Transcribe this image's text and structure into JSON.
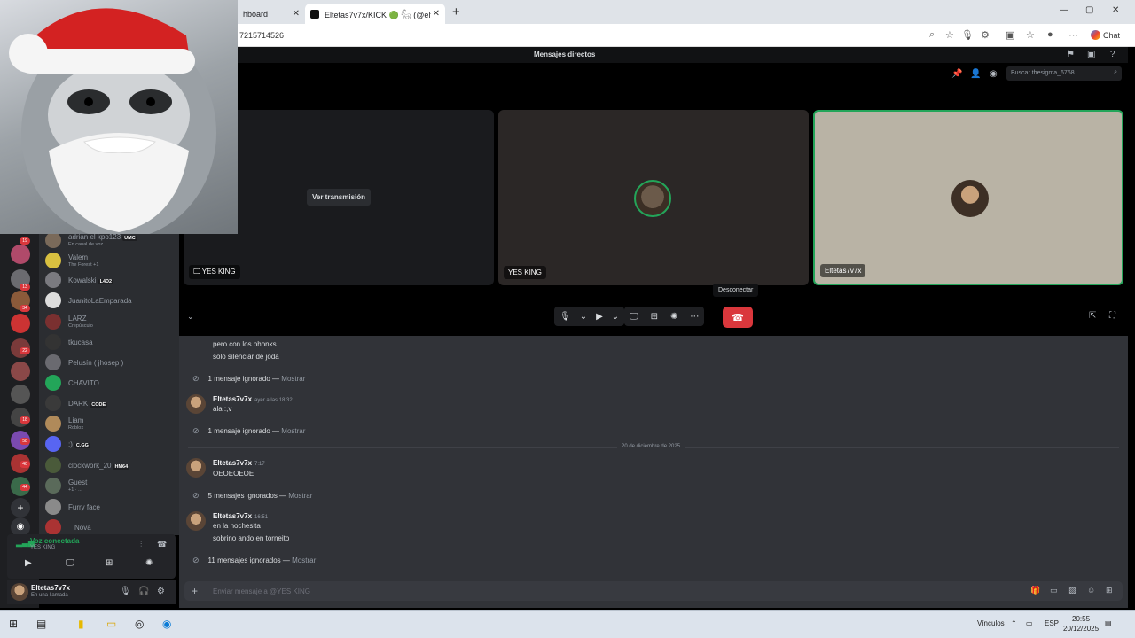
{
  "browser": {
    "tabs": [
      {
        "label": "hboard"
      },
      {
        "label": "Eltetas7v7x/KICK 🟢 𓃵 (@elteta:"
      }
    ],
    "new_tab": "+",
    "url": "7215714526",
    "chat_label": "Chat"
  },
  "discord": {
    "top_title": "Mensajes directos",
    "search_placeholder": "Buscar thesigma_6768",
    "call": {
      "tiles": [
        {
          "label": "YES KING",
          "button": "Ver transmisión"
        },
        {
          "label": "YES KING"
        },
        {
          "label": "Eltetas7v7x"
        }
      ],
      "tooltip": "Desconectar"
    },
    "dm_list": [
      {
        "name": "adrian el kpo123",
        "sub": "En canal de voz",
        "tag": "UMC"
      },
      {
        "name": "Valem",
        "sub": "The Forest +1",
        "tag": ""
      },
      {
        "name": "Kowalski",
        "sub": "",
        "tag": "L4D2"
      },
      {
        "name": "JuanitoLaEmparada",
        "sub": "",
        "tag": ""
      },
      {
        "name": "LARZ",
        "sub": "Crepúsculo",
        "tag": ""
      },
      {
        "name": "tkucasa",
        "sub": "",
        "tag": ""
      },
      {
        "name": "Pelusín ( jhosep )",
        "sub": "",
        "tag": ""
      },
      {
        "name": "CHAVITO",
        "sub": "",
        "tag": ""
      },
      {
        "name": "DARK",
        "sub": "",
        "tag": "CODE"
      },
      {
        "name": "Liam",
        "sub": "Roblox",
        "tag": ""
      },
      {
        "name": ":)",
        "sub": "",
        "tag": "C.GG"
      },
      {
        "name": "clockwork_20",
        "sub": "",
        "tag": "HM64"
      },
      {
        "name": "Guest_",
        "sub": "+1 · ...",
        "tag": ""
      },
      {
        "name": "Furry face",
        "sub": "",
        "tag": ""
      },
      {
        "name": "Nova",
        "sub": "",
        "tag": ""
      }
    ],
    "guild_badges": [
      "19",
      "13",
      "34",
      "22",
      "18",
      "58",
      "40",
      "44"
    ],
    "voice": {
      "status": "Voz conectada",
      "channel": "YES KING"
    },
    "user": {
      "name": "Eltetas7v7x",
      "status": "En una llamada"
    },
    "messages": {
      "line1": "pero con los phonks",
      "line2": "solo silenciar de joda",
      "ignored1": "1 mensaje ignorado —",
      "show": "Mostrar",
      "m1": {
        "user": "Eltetas7v7x",
        "time": "ayer a las 18:32",
        "text": "ala :,v"
      },
      "ignored2": "1 mensaje ignorado —",
      "date_sep": "20 de diciembre de 2025",
      "m2": {
        "user": "Eltetas7v7x",
        "time": "7:17",
        "text": "OEOEOEOE"
      },
      "ignored3": "5 mensajes ignorados —",
      "m3": {
        "user": "Eltetas7v7x",
        "time": "16:51",
        "text1": "en la nochesita",
        "text2": "sobrino ando en torneito"
      },
      "ignored4": "11 mensajes ignorados —"
    },
    "composer_placeholder": "Enviar mensaje a @YES KING"
  },
  "taskbar": {
    "links_label": "Vínculos",
    "lang": "ESP",
    "time": "20:55",
    "date": "20/12/2025"
  },
  "colors": {
    "accent": "#23a559",
    "hangup": "#da373c",
    "bg_chat": "#313338"
  }
}
